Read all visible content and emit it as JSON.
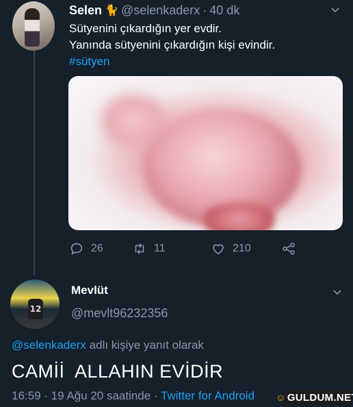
{
  "tweet1": {
    "author_name": "Selen",
    "author_emoji": "🐈",
    "handle": "@selenkaderx",
    "separator": "·",
    "time": "40 dk",
    "lines": [
      "Sütyenini çıkardığın yer evdir.",
      "Yanında sütyenini çıkardığın kişi evindir."
    ],
    "hashtag": "#sütyen",
    "stats": {
      "replies": "26",
      "retweets": "11",
      "likes": "210"
    }
  },
  "tweet2": {
    "author_name": "Mevlüt",
    "handle": "@mevlt96232356",
    "avatar_jersey_number": "12",
    "reply_to_handle": "@selenkaderx",
    "reply_to_suffix": " adlı kişiye yanıt olarak",
    "text": "CAMİİ  ALLAHIN EVİDİR",
    "timestamp": "16:59 · 19 Ağu 20 saatinde · ",
    "source": "Twitter for Android"
  },
  "watermark": {
    "text": "GULDUM.NET"
  },
  "colors": {
    "background": "#15202b",
    "muted": "#8899a6",
    "accent": "#1da1f2",
    "divider": "#38444d"
  },
  "icons": [
    "reply-icon",
    "retweet-icon",
    "like-icon",
    "share-icon",
    "chevron-down-icon"
  ]
}
